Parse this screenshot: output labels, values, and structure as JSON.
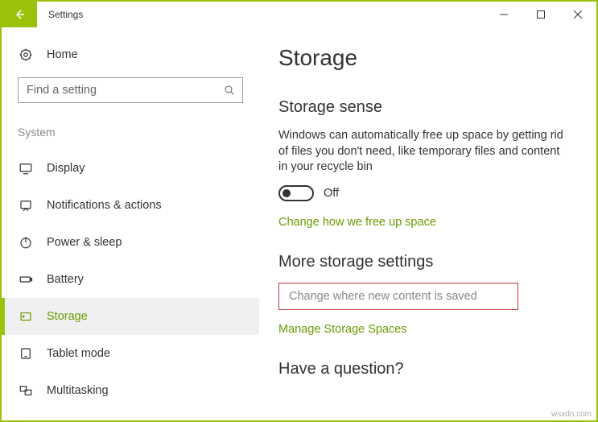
{
  "app_title": "Settings",
  "sidebar": {
    "home_label": "Home",
    "search_placeholder": "Find a setting",
    "group_label": "System",
    "items": [
      {
        "label": "Display"
      },
      {
        "label": "Notifications & actions"
      },
      {
        "label": "Power & sleep"
      },
      {
        "label": "Battery"
      },
      {
        "label": "Storage"
      },
      {
        "label": "Tablet mode"
      },
      {
        "label": "Multitasking"
      }
    ]
  },
  "main": {
    "page_title": "Storage",
    "sense_title": "Storage sense",
    "sense_desc": "Windows can automatically free up space by getting rid of files you don't need, like temporary files and content in your recycle bin",
    "toggle_state": "Off",
    "link_change_free": "Change how we free up space",
    "more_title": "More storage settings",
    "link_change_where": "Change where new content is saved",
    "link_manage": "Manage Storage Spaces",
    "question_title": "Have a question?"
  },
  "watermark": "wsxdn.com"
}
